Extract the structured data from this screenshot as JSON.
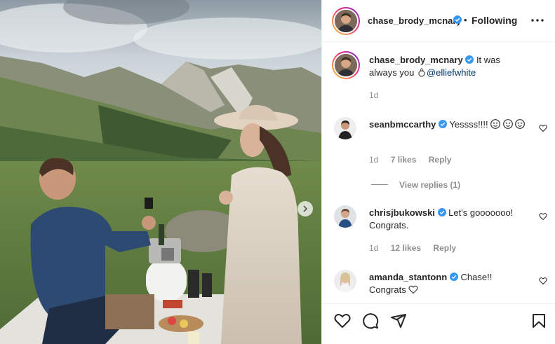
{
  "post": {
    "author": "chase_brody_mcnary",
    "follow_status": "Following",
    "dot": "•",
    "caption_text": "It was always you",
    "caption_mention": "@elliefwhite",
    "caption_time": "1d"
  },
  "comments": [
    {
      "username": "seanbmccarthy",
      "text": "Yessss!!!!",
      "time": "1d",
      "likes": "7 likes",
      "reply": "Reply",
      "view_replies": "View replies (1)"
    },
    {
      "username": "chrisjbukowski",
      "text": "Let's gooooooo! Congrats.",
      "time": "1d",
      "likes": "12 likes",
      "reply": "Reply"
    },
    {
      "username": "amanda_stantonn",
      "text": "Chase!! Congrats"
    }
  ],
  "colors": {
    "verified": "#3897f0",
    "mention": "#00376b",
    "secondary_text": "#8e8e8e"
  },
  "icons": [
    "heart-icon",
    "comment-icon",
    "share-icon",
    "bookmark-icon",
    "more-options-icon",
    "verified-badge-icon",
    "carousel-next-icon"
  ]
}
